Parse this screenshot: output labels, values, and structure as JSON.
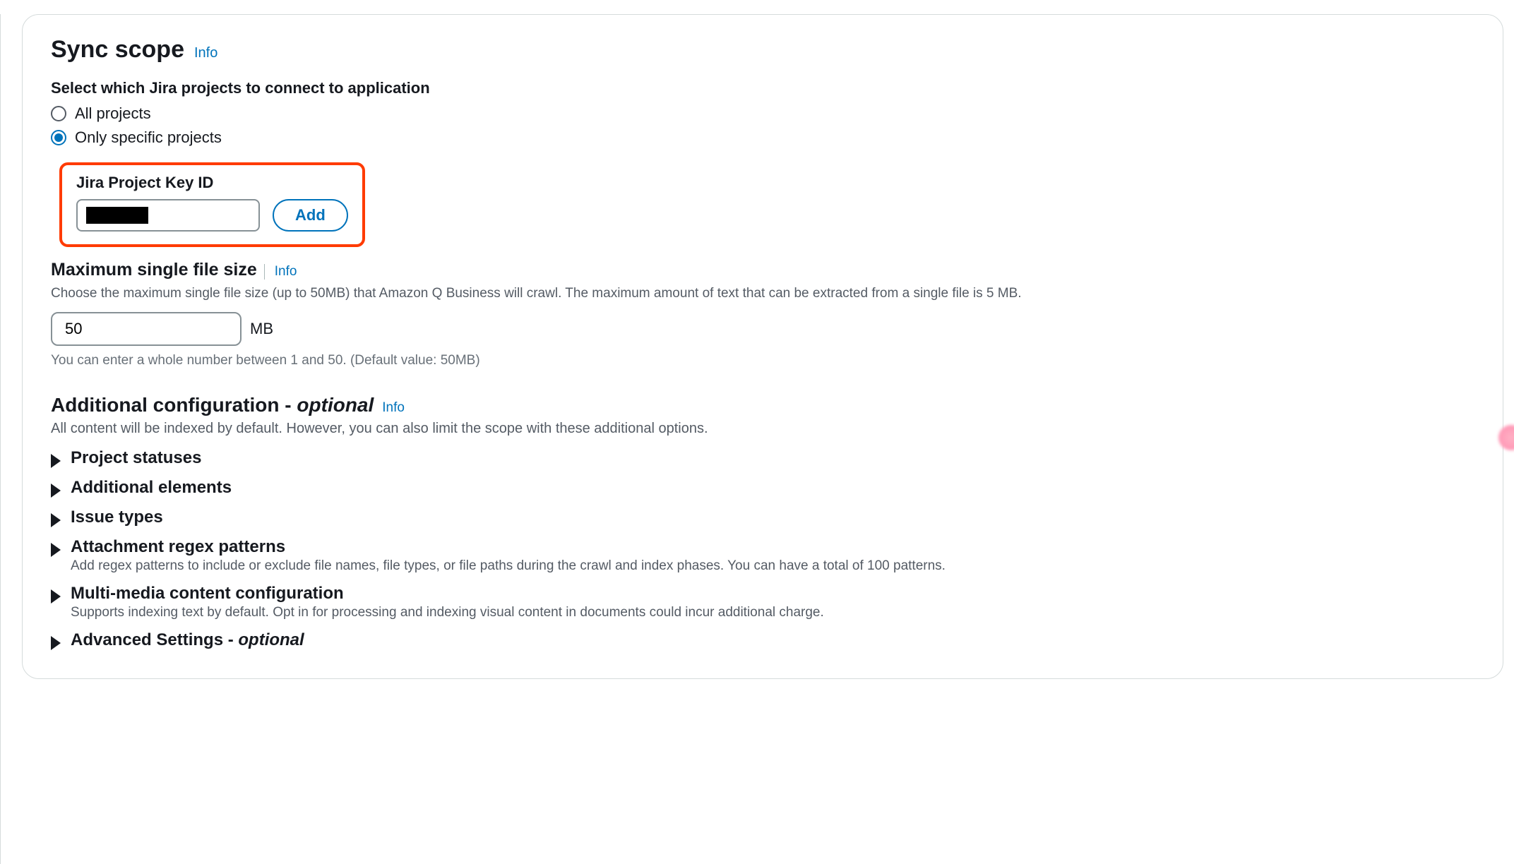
{
  "panel": {
    "title": "Sync scope",
    "info_link": "Info"
  },
  "project_select": {
    "label": "Select which Jira projects to connect to application",
    "option_all": "All projects",
    "option_specific": "Only specific projects"
  },
  "jira_key": {
    "label": "Jira Project Key ID",
    "add_button": "Add"
  },
  "file_size": {
    "label": "Maximum single file size",
    "info_link": "Info",
    "description": "Choose the maximum single file size (up to 50MB) that Amazon Q Business will crawl. The maximum amount of text that can be extracted from a single file is 5 MB.",
    "value": "50",
    "unit": "MB",
    "hint": "You can enter a whole number between 1 and 50. (Default value: 50MB)"
  },
  "additional_config": {
    "heading": "Additional configuration - ",
    "optional": "optional",
    "info_link": "Info",
    "description": "All content will be indexed by default. However, you can also limit the scope with these additional options."
  },
  "expandables": {
    "project_statuses": "Project statuses",
    "additional_elements": "Additional elements",
    "issue_types": "Issue types",
    "attachment_regex": {
      "title": "Attachment regex patterns",
      "desc": "Add regex patterns to include or exclude file names, file types, or file paths during the crawl and index phases. You can have a total of 100 patterns."
    },
    "multimedia": {
      "title": "Multi-media content configuration",
      "desc": "Supports indexing text by default. Opt in for processing and indexing visual content in documents could incur additional charge."
    },
    "advanced": {
      "title": "Advanced Settings - ",
      "optional": "optional"
    }
  }
}
